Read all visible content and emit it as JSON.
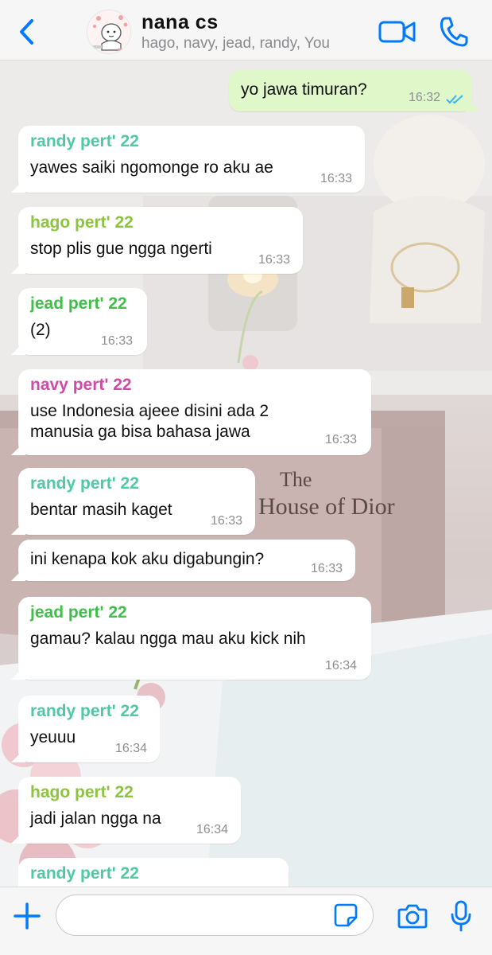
{
  "header": {
    "title": "nana cs",
    "members": "hago, navy, jead, randy, You"
  },
  "colors": {
    "accent": "#007aff",
    "outgoing_bubble": "#e0f7c9",
    "incoming_bubble": "#ffffff",
    "randy": "#4ec9a4",
    "hago": "#8cc43f",
    "jead": "#3fbf4a",
    "navy": "#d04aa7",
    "read_ticks": "#34b7f1"
  },
  "background_scene": {
    "book_title": "The House of Dior"
  },
  "messages": [
    {
      "direction": "out",
      "text": "yo jawa timuran?",
      "time": "16:32",
      "status": "read"
    },
    {
      "direction": "in",
      "sender": "randy pert' 22",
      "text": "yawes saiki ngomonge ro aku ae",
      "time": "16:33"
    },
    {
      "direction": "in",
      "sender": "hago pert' 22",
      "text": "stop plis gue ngga ngerti",
      "time": "16:33"
    },
    {
      "direction": "in",
      "sender": "jead pert' 22",
      "text": "(2)",
      "time": "16:33"
    },
    {
      "direction": "in",
      "sender": "navy pert' 22",
      "text_line1": "use Indonesia ajeee disini ada 2",
      "text_line2": "manusia ga bisa bahasa jawa",
      "time": "16:33"
    },
    {
      "direction": "in",
      "sender": "randy pert' 22",
      "text": "bentar masih kaget",
      "time": "16:33"
    },
    {
      "direction": "in",
      "text": "ini kenapa kok aku digabungin?",
      "time": "16:33"
    },
    {
      "direction": "in",
      "sender": "jead pert' 22",
      "text": "gamau? kalau ngga mau aku kick nih",
      "time": "16:34"
    },
    {
      "direction": "in",
      "sender": "randy pert' 22",
      "text": "yeuuu",
      "time": "16:34"
    },
    {
      "direction": "in",
      "sender": "hago pert' 22",
      "text": "jadi jalan ngga na",
      "time": "16:34"
    },
    {
      "direction": "in",
      "sender": "randy pert' 22",
      "text": "",
      "time": ""
    }
  ],
  "composer": {
    "value": "",
    "placeholder": ""
  },
  "icons": {
    "back": "chevron-left-icon",
    "video": "video-camera-icon",
    "call": "phone-icon",
    "plus": "plus-icon",
    "sticker": "sticker-icon",
    "camera": "camera-icon",
    "mic": "microphone-icon"
  }
}
